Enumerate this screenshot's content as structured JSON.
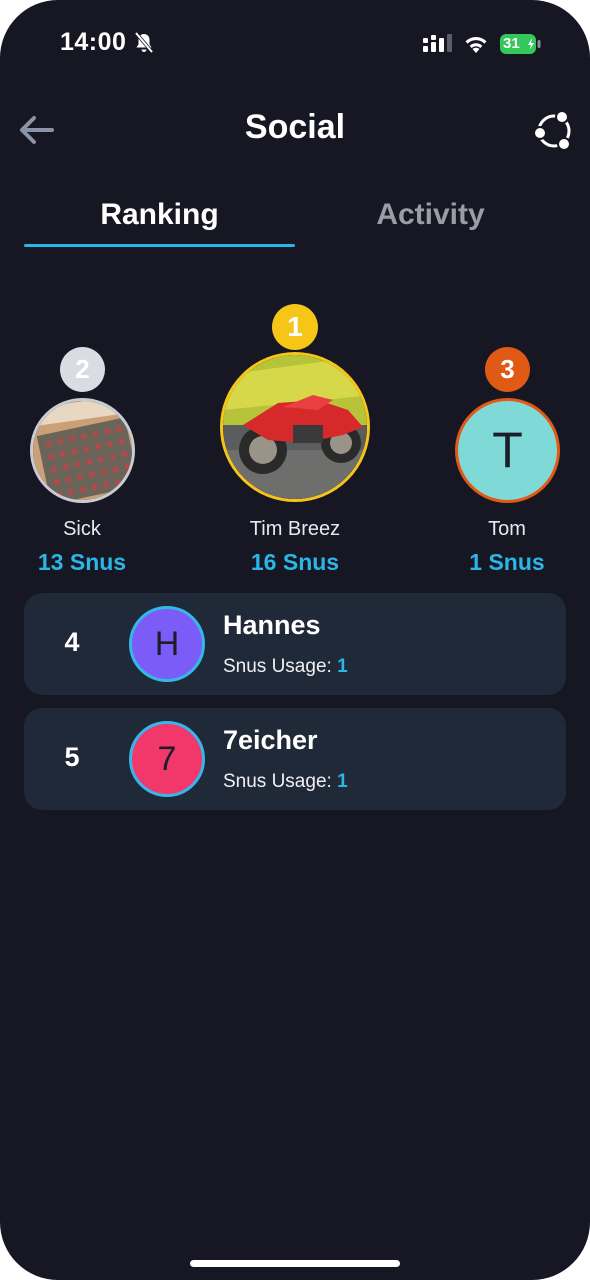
{
  "status_bar": {
    "time": "14:00",
    "battery": "31"
  },
  "header": {
    "title": "Social"
  },
  "tabs": [
    {
      "label": "Ranking",
      "active": true
    },
    {
      "label": "Activity",
      "active": false
    }
  ],
  "podium": [
    {
      "rank": "2",
      "name": "Sick",
      "score": "13 Snus",
      "avatar_type": "photo",
      "badge_color": "#d9dde3"
    },
    {
      "rank": "1",
      "name": "Tim Breez",
      "score": "16 Snus",
      "avatar_type": "photo",
      "badge_color": "#f5c518"
    },
    {
      "rank": "3",
      "name": "Tom",
      "score": "1 Snus",
      "avatar_type": "initial",
      "initial": "T",
      "avatar_color": "#7fd9d6",
      "badge_color": "#e05a16"
    }
  ],
  "list": [
    {
      "rank": "4",
      "initial": "H",
      "name": "Hannes",
      "usage_label": "Snus Usage: ",
      "usage_value": "1",
      "avatar_color": "#7b5cf6"
    },
    {
      "rank": "5",
      "initial": "7",
      "name": "7eicher",
      "usage_label": "Snus Usage: ",
      "usage_value": "1",
      "avatar_color": "#f2386b"
    }
  ],
  "colors": {
    "accent": "#2ab7e8",
    "background": "#161722",
    "card": "#202938"
  }
}
